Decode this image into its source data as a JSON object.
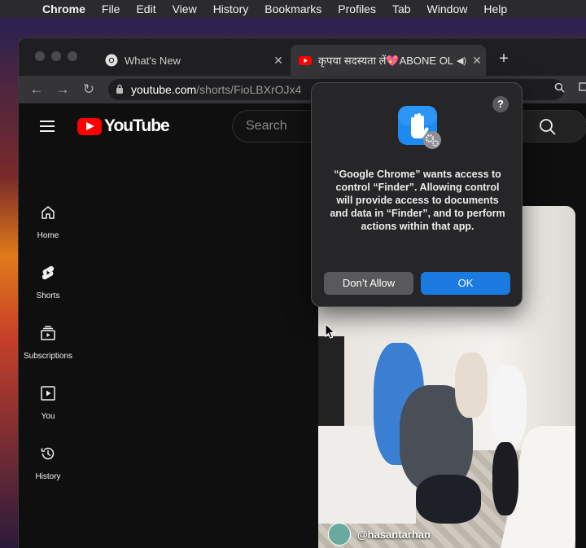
{
  "menubar": {
    "apple_icon": "apple-logo-icon",
    "items": [
      "Chrome",
      "File",
      "Edit",
      "View",
      "History",
      "Bookmarks",
      "Profiles",
      "Tab",
      "Window",
      "Help"
    ]
  },
  "tabs": [
    {
      "title": "What's New",
      "icon": "chrome-icon",
      "close": "✕"
    },
    {
      "title": "कृपया सदस्यता लें💖ABONE OL",
      "icon": "youtube-favicon",
      "close": "✕",
      "audio_icon": "speaker-icon"
    }
  ],
  "toolbar": {
    "url_host": "youtube.com",
    "url_path": "/shorts/FioLBXrOJx4",
    "new_tab": "+"
  },
  "youtube": {
    "logo_text": "YouTube",
    "search_placeholder": "Search",
    "guide": [
      {
        "label": "Home",
        "icon": "home-icon"
      },
      {
        "label": "Shorts",
        "icon": "shorts-icon"
      },
      {
        "label": "Subscriptions",
        "icon": "subscriptions-icon"
      },
      {
        "label": "You",
        "icon": "you-icon"
      },
      {
        "label": "History",
        "icon": "history-icon"
      }
    ],
    "video": {
      "channel": "@hasantarhan"
    }
  },
  "dialog": {
    "help": "?",
    "message": "“Google Chrome” wants access to control “Finder”. Allowing control will provide access to documents and data in “Finder”, and to perform actions within that app.",
    "deny_label": "Don’t Allow",
    "ok_label": "OK",
    "accent": "#1b7ae0"
  }
}
